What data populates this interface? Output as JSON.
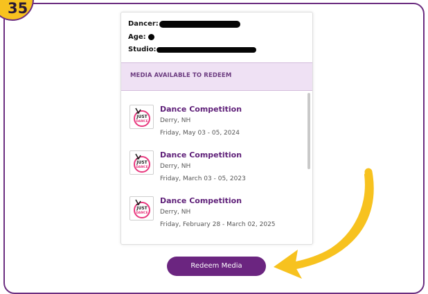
{
  "step_badge": {
    "number": "35"
  },
  "dancer_info": {
    "dancer_label": "Dancer:",
    "age_label": "Age:",
    "studio_label": "Studio:"
  },
  "media_section": {
    "heading": "MEDIA AVAILABLE TO REDEEM",
    "events": [
      {
        "title": "Dance Competition",
        "location": "Derry, NH",
        "date": "Friday, May 03 - 05, 2024",
        "logo": "just-dance-logo-icon"
      },
      {
        "title": "Dance Competition",
        "location": "Derry, NH",
        "date": "Friday, March 03 - 05, 2023",
        "logo": "just-dance-logo-icon"
      },
      {
        "title": "Dance Competition",
        "location": "Derry, NH",
        "date": "Friday, February 28 - March 02, 2025",
        "logo": "just-dance-logo-icon"
      }
    ]
  },
  "redeem_button": {
    "label": "Redeem Media"
  },
  "logo_text": {
    "line1": "JUST",
    "line2": "DANCE"
  },
  "colors": {
    "brand_purple": "#6b2580",
    "highlight_bg": "#efe1f4",
    "arrow_yellow": "#f7c21f",
    "logo_pink": "#e8367d"
  }
}
